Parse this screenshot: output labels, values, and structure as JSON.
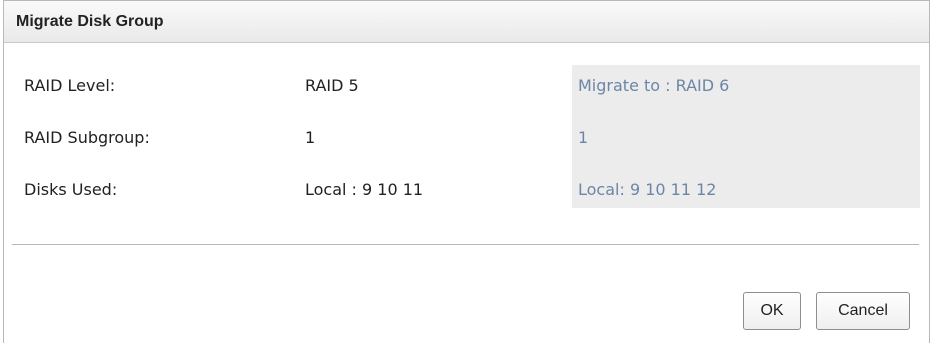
{
  "dialog": {
    "title": "Migrate Disk Group"
  },
  "fields": [
    {
      "label": "RAID Level:",
      "current": "RAID 5",
      "target": "Migrate to : RAID 6"
    },
    {
      "label": "RAID Subgroup:",
      "current": "1",
      "target": "1"
    },
    {
      "label": "Disks Used:",
      "current": "Local : 9 10 11",
      "target": "Local: 9 10 11 12"
    }
  ],
  "buttons": {
    "ok": "OK",
    "cancel": "Cancel"
  }
}
